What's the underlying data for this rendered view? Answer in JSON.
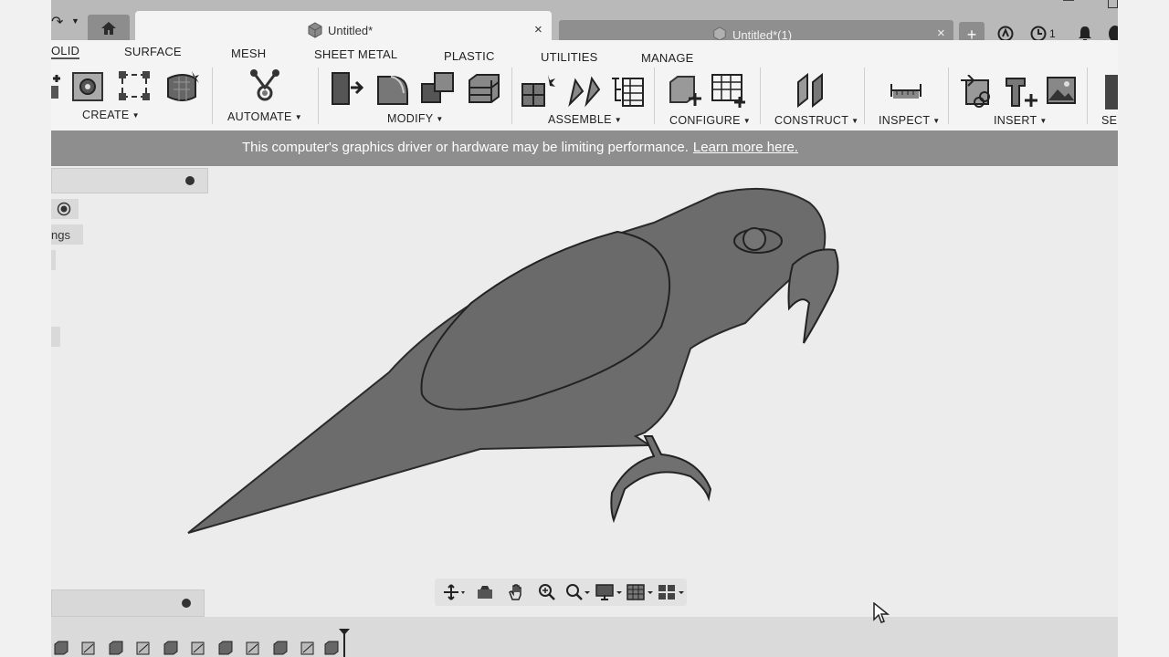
{
  "tabs": {
    "active_title": "Untitled*",
    "inactive_title": "Untitled*(1)",
    "close_glyph": "×",
    "add_glyph": "+",
    "clock_count": "1"
  },
  "ribbon": {
    "tabs": [
      "OLID",
      "SURFACE",
      "MESH",
      "SHEET METAL",
      "PLASTIC",
      "UTILITIES",
      "MANAGE"
    ],
    "groups": {
      "create": "CREATE",
      "automate": "AUTOMATE",
      "modify": "MODIFY",
      "assemble": "ASSEMBLE",
      "configure": "CONFIGURE",
      "construct": "CONSTRUCT",
      "inspect": "INSPECT",
      "insert": "INSERT",
      "select": "SE"
    }
  },
  "warning": {
    "message": "This computer's graphics driver or hardware may be limiting performance.",
    "link": "Learn more here."
  },
  "browser": {
    "item_label": "ngs"
  },
  "colors": {
    "shape_fill": "#6c6c6c",
    "warning_bar": "#8e8e8e"
  }
}
